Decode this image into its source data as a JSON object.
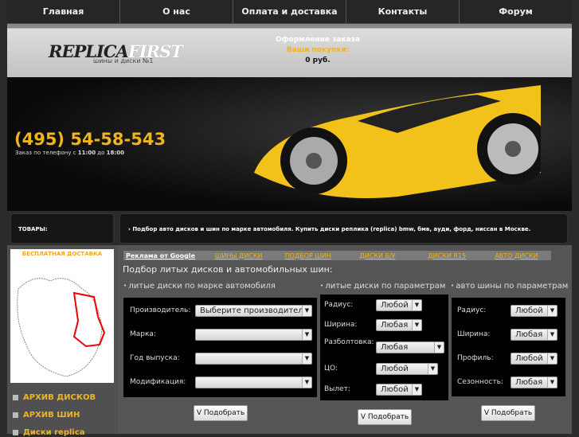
{
  "nav": [
    "Главная",
    "О нас",
    "Оплата и доставка",
    "Контакты",
    "Форум"
  ],
  "logo": {
    "part1": "REPLICA",
    "part2": "FIRST",
    "tagline": "шины и диски №1"
  },
  "cart": {
    "title": "Оформление заказа",
    "label": "Ваши покупки:",
    "total": "0 руб."
  },
  "phone": {
    "number": "(495) 54-58-543",
    "note_prefix": "Заказ по телефону с ",
    "from": "11:00",
    "mid": " до ",
    "to": "18:00"
  },
  "tovary": "ТОВАРЫ:",
  "info": "› Подбор авто дисков и шин по марке автомобиля. Купить диски реплика (replica) bmw, бмв, ауди, форд, ниссан в Москве.",
  "map_title": "БЕСПЛАТНАЯ ДОСТАВКА",
  "side_links": [
    "АРХИВ ДИСКОВ",
    "АРХИВ ШИН",
    "Диски replica"
  ],
  "ads": {
    "label": "Реклама от Google",
    "links": [
      "ШИНЫ ДИСКИ",
      "ПОДБОР ШИН",
      "ДИСКИ Б/У",
      "ДИСКИ R15",
      "АВТО ДИСКИ"
    ]
  },
  "heading": "Подбор литых дисков и автомобильных шин:",
  "form1": {
    "title": "литые диски по марке автомобиля",
    "fields": [
      {
        "label": "Производитель:",
        "value": "Выберите производителя"
      },
      {
        "label": "Марка:",
        "value": ""
      },
      {
        "label": "Год выпуска:",
        "value": ""
      },
      {
        "label": "Модификация:",
        "value": ""
      }
    ],
    "button": "V Подобрать"
  },
  "form2": {
    "title": "литые диски по параметрам",
    "fields": [
      {
        "label": "Радиус:",
        "value": "Любой"
      },
      {
        "label": "Ширина:",
        "value": "Любая"
      },
      {
        "label": "Разболтовка:",
        "value": "Любая"
      },
      {
        "label": "ЦО:",
        "value": "Любой"
      },
      {
        "label": "Вылет:",
        "value": "Любой"
      }
    ],
    "button": "V Подобрать"
  },
  "form3": {
    "title": "авто шины по параметрам",
    "fields": [
      {
        "label": "Радиус:",
        "value": "Любой"
      },
      {
        "label": "Ширина:",
        "value": "Любая"
      },
      {
        "label": "Профиль:",
        "value": "Любой"
      },
      {
        "label": "Сезонность:",
        "value": "Любая"
      }
    ],
    "button": "V Подобрать"
  }
}
